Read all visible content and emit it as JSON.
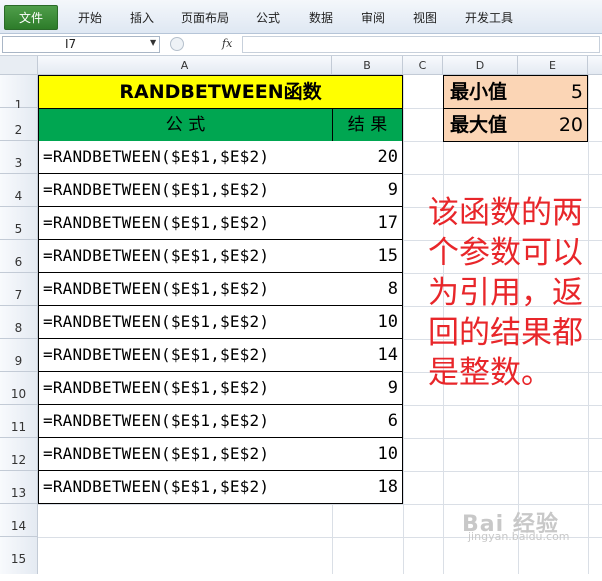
{
  "ribbon": {
    "tabs": [
      "文件",
      "开始",
      "插入",
      "页面布局",
      "公式",
      "数据",
      "审阅",
      "视图",
      "开发工具"
    ]
  },
  "formula_bar": {
    "name_box": "I7",
    "fx": "fx",
    "value": ""
  },
  "columns": [
    "A",
    "B",
    "C",
    "D",
    "E"
  ],
  "rows": [
    "1",
    "2",
    "3",
    "4",
    "5",
    "6",
    "7",
    "8",
    "9",
    "10",
    "11",
    "12",
    "13",
    "14",
    "15"
  ],
  "table": {
    "title": "RANDBETWEEN函数",
    "header_formula": "公 式",
    "header_result": "结 果",
    "rows": [
      {
        "formula": "=RANDBETWEEN($E$1,$E$2)",
        "result": "20"
      },
      {
        "formula": "=RANDBETWEEN($E$1,$E$2)",
        "result": "9"
      },
      {
        "formula": "=RANDBETWEEN($E$1,$E$2)",
        "result": "17"
      },
      {
        "formula": "=RANDBETWEEN($E$1,$E$2)",
        "result": "15"
      },
      {
        "formula": "=RANDBETWEEN($E$1,$E$2)",
        "result": "8"
      },
      {
        "formula": "=RANDBETWEEN($E$1,$E$2)",
        "result": "10"
      },
      {
        "formula": "=RANDBETWEEN($E$1,$E$2)",
        "result": "14"
      },
      {
        "formula": "=RANDBETWEEN($E$1,$E$2)",
        "result": "9"
      },
      {
        "formula": "=RANDBETWEEN($E$1,$E$2)",
        "result": "6"
      },
      {
        "formula": "=RANDBETWEEN($E$1,$E$2)",
        "result": "10"
      },
      {
        "formula": "=RANDBETWEEN($E$1,$E$2)",
        "result": "18"
      }
    ]
  },
  "params": {
    "min_label": "最小值",
    "min_value": "5",
    "max_label": "最大值",
    "max_value": "20"
  },
  "note": "该函数的两个参数可以为引用，返回的结果都是整数。",
  "watermark": {
    "text": "Bai 经验",
    "sub": "jingyan.baidu.com"
  },
  "colors": {
    "title_bg": "#ffff00",
    "header_bg": "#00a651",
    "param_bg": "#fbd5b5",
    "note": "#e8262a",
    "file_tab": "#2d7c2a"
  }
}
